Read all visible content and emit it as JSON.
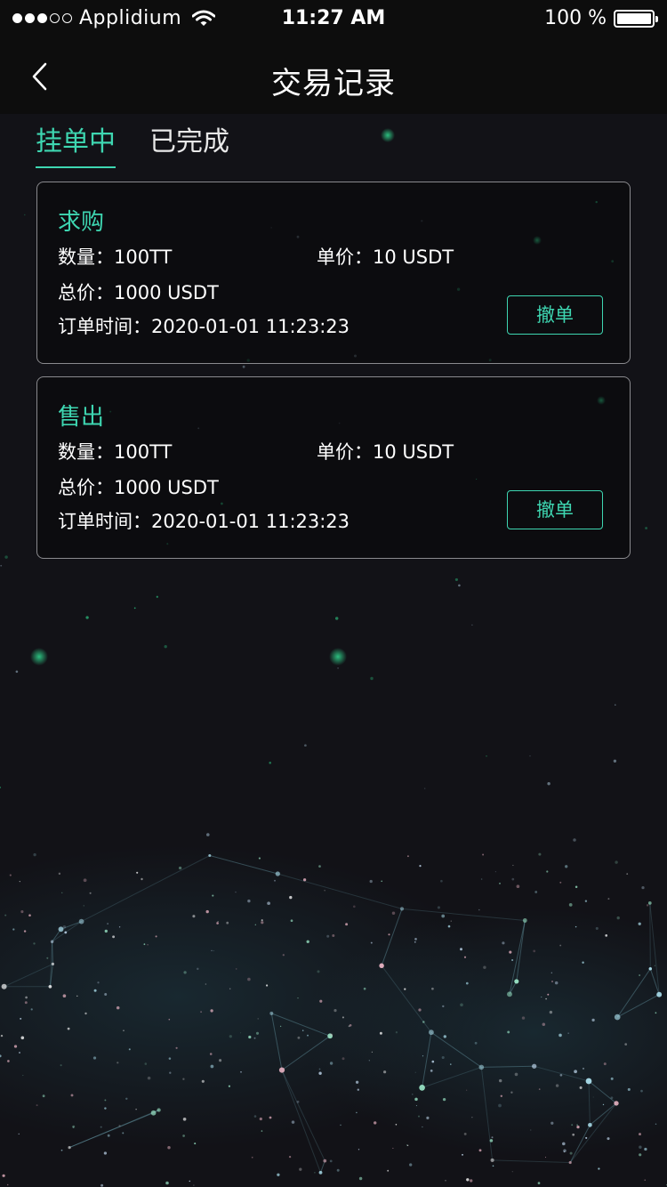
{
  "status_bar": {
    "carrier": "Applidium",
    "time": "11:27 AM",
    "battery": "100 %",
    "signal_bars_filled": 3,
    "signal_bars_total": 5
  },
  "nav": {
    "title": "交易记录",
    "back_icon": "chevron-left-icon"
  },
  "tabs": [
    {
      "label": "挂单中",
      "active": true
    },
    {
      "label": "已完成",
      "active": false
    }
  ],
  "orders": [
    {
      "type": "求购",
      "quantity_label": "数量：",
      "quantity": "100TT",
      "price_label": "单价：",
      "price": "10 USDT",
      "total_label": "总价：",
      "total": "1000 USDT",
      "time_label": "订单时间：",
      "time": "2020-01-01 11:23:23",
      "action": "撤单"
    },
    {
      "type": "售出",
      "quantity_label": "数量：",
      "quantity": "100TT",
      "price_label": "单价：",
      "price": "10 USDT",
      "total_label": "总价：",
      "total": "1000 USDT",
      "time_label": "订单时间：",
      "time": "2020-01-01 11:23:23",
      "action": "撤单"
    }
  ],
  "colors": {
    "accent": "#3ed6b1",
    "background": "#121217",
    "bar": "#0d0d0d",
    "card_border": "#8a8a8e"
  }
}
